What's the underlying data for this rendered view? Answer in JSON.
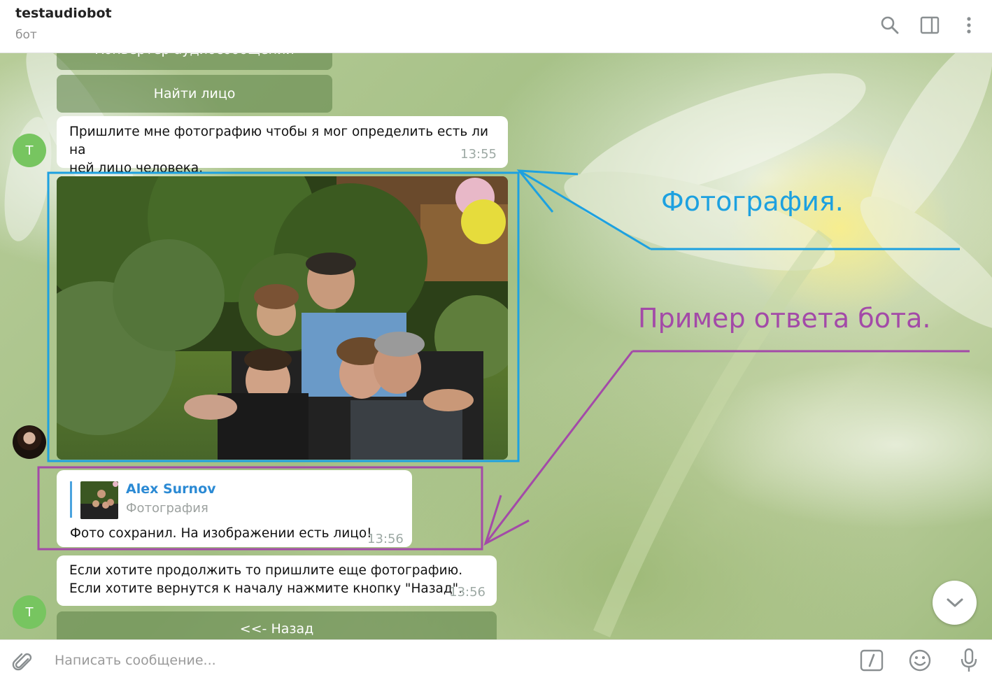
{
  "header": {
    "title": "testaudiobot",
    "subtitle": "бот",
    "icons": [
      "search-icon",
      "sidebar-toggle-icon",
      "more-vertical-icon"
    ]
  },
  "keyboard_top": {
    "partial_label": "Конвертер аудиосообщений",
    "find_face_label": "Найти лицо"
  },
  "messages": {
    "bot_prompt": {
      "avatar_letter": "T",
      "text": "Пришлите мне фотографию чтобы я мог определить есть ли на\nней лицо человека.",
      "time": "13:55"
    },
    "bot_reply": {
      "reply_name": "Alex Surnov",
      "reply_type": "Фотография",
      "text": "Фото сохранил. На изображении есть лицо!",
      "time": "13:56"
    },
    "bot_continue": {
      "avatar_letter": "T",
      "text": "Если хотите продолжить то пришлите еще фотографию.\nЕсли хотите вернутся к началу нажмите кнопку \"Назад\".",
      "time": "13:56"
    }
  },
  "keyboard_bottom": {
    "back_label": "<<- Назад"
  },
  "annotations": {
    "photo_label": "Фотография.",
    "reply_label": "Пример ответа бота.",
    "photo_color": "#1da1e0",
    "reply_color": "#a34aa8"
  },
  "composer": {
    "placeholder": "Написать сообщение...",
    "icons": [
      "paperclip-icon",
      "bot-command-icon",
      "emoji-icon",
      "microphone-icon"
    ]
  },
  "colors": {
    "avatar_green": "#77c560",
    "link_blue": "#2b8ad4",
    "keyboard_button": "#64874e"
  }
}
